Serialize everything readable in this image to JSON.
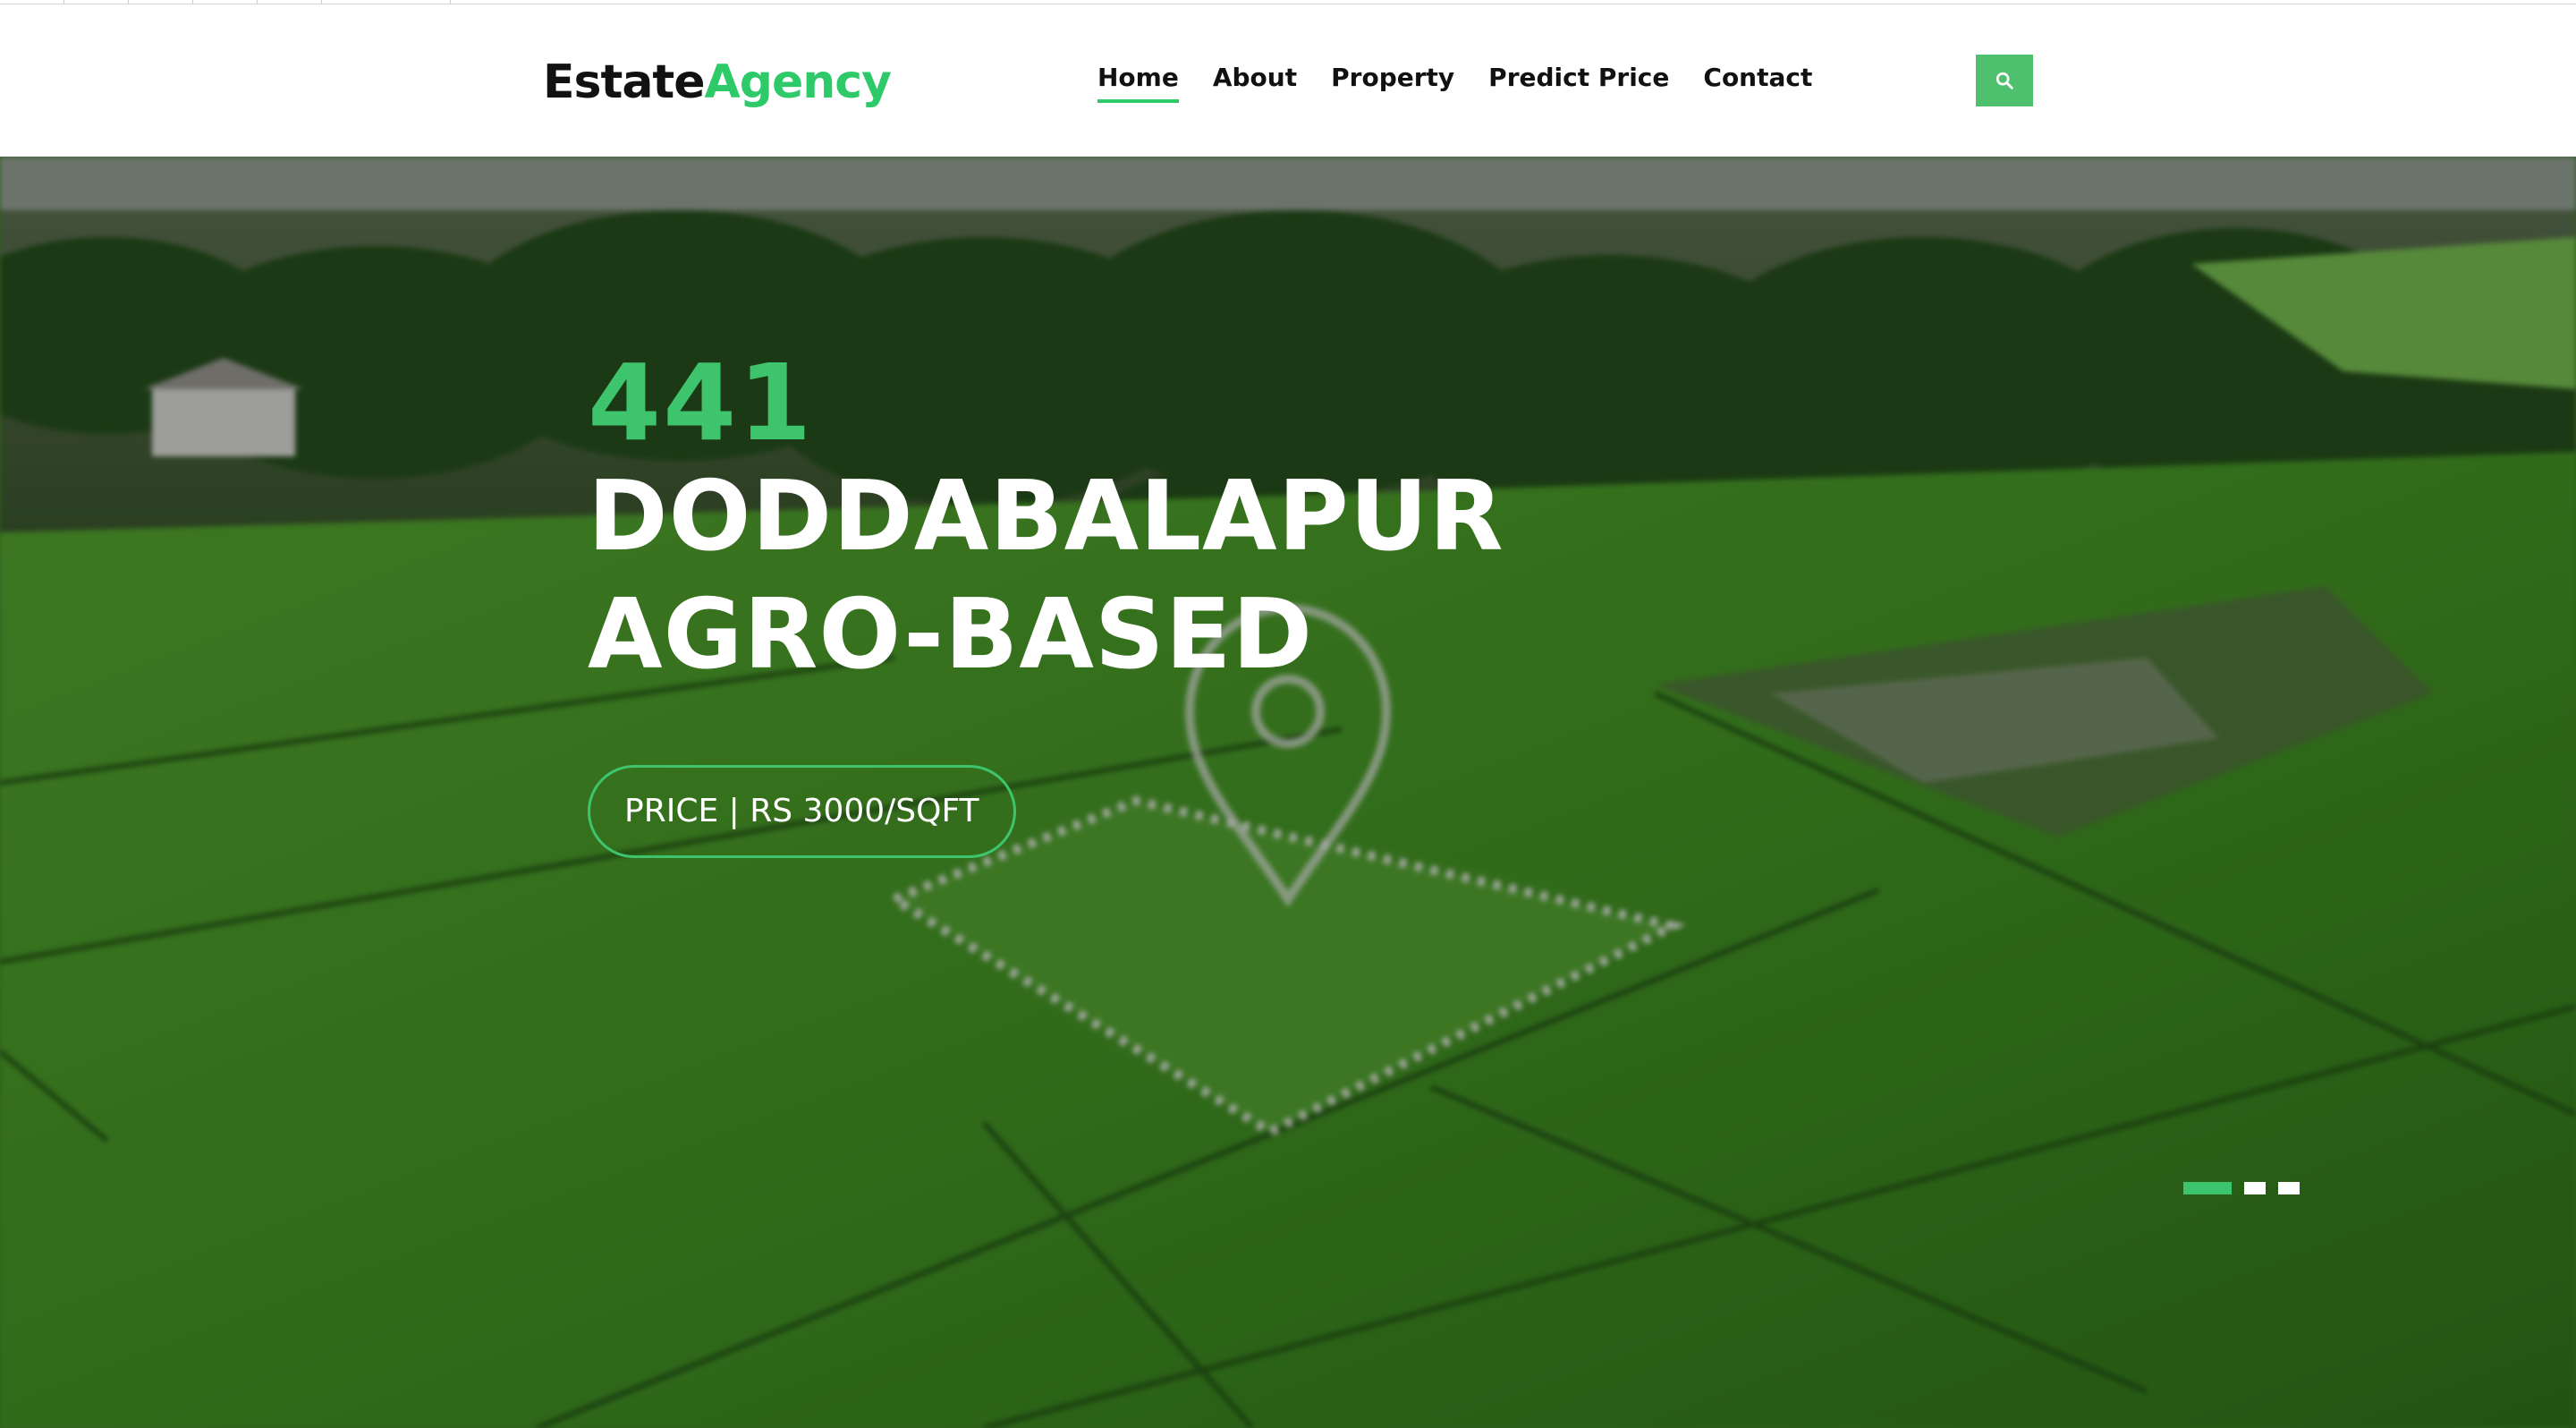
{
  "brand": {
    "part1": "Estate",
    "part2": "Agency"
  },
  "nav": {
    "items": [
      {
        "label": "Home",
        "active": true
      },
      {
        "label": "About",
        "active": false
      },
      {
        "label": "Property",
        "active": false
      },
      {
        "label": "Predict Price",
        "active": false
      },
      {
        "label": "Contact",
        "active": false
      }
    ],
    "search_icon": "search-icon"
  },
  "hero": {
    "number": "441",
    "title_line1": "DODDABALAPUR",
    "title_line2": "AGRO-BASED",
    "price_label": "PRICE | RS 3000/SQFT",
    "background": "aerial-green-farmland-with-location-pin",
    "carousel": {
      "total_slides": 3,
      "active_index": 0
    }
  },
  "colors": {
    "accent": "#2eca6a",
    "text_dark": "#111111",
    "hero_text": "#ffffff"
  }
}
